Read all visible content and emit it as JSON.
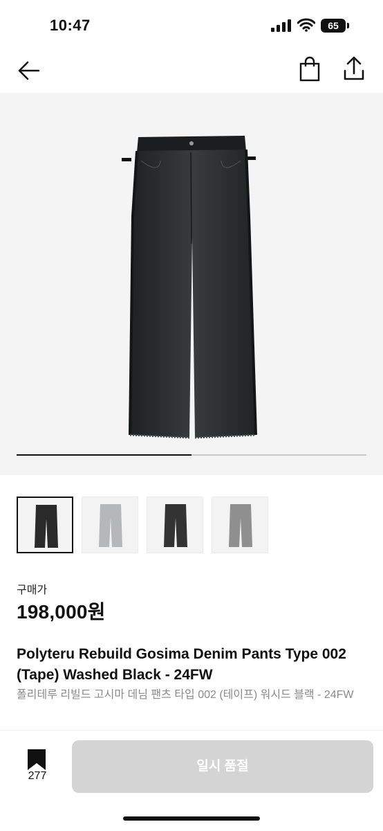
{
  "status_bar": {
    "time": "10:47",
    "battery": "65"
  },
  "nav": {
    "back_icon": "arrow-left-icon",
    "bag_icon": "shopping-bag-icon",
    "share_icon": "share-icon"
  },
  "gallery": {
    "progress": 0.5,
    "thumbnail_colors": [
      "#2a2a2a",
      "#b5b8bb",
      "#333333",
      "#8f8f8f"
    ],
    "selected_index": 0
  },
  "price": {
    "label": "구매가",
    "value": "198,000원"
  },
  "product": {
    "title": "Polyteru Rebuild Gosima Denim Pants Type 002 (Tape) Washed Black - 24FW",
    "subtitle": "폴리테루 리빌드 고시마 데님 팬츠 타입 002 (테이프) 워시드 블랙 - 24FW"
  },
  "bottom_bar": {
    "bookmark_count": "277",
    "buy_label": "일시 품절"
  }
}
